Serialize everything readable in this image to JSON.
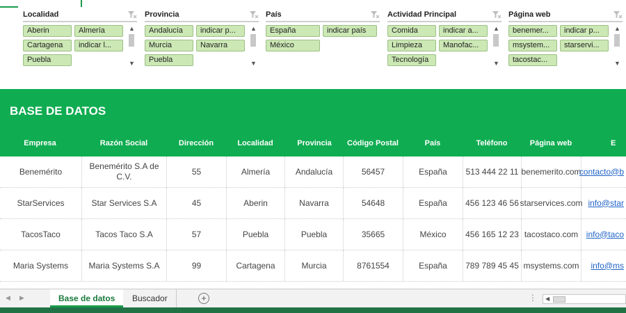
{
  "slicers": [
    {
      "title": "Localidad",
      "items": [
        "Aberin",
        "Almería",
        "Cartagena",
        "indicar l...",
        "Puebla"
      ]
    },
    {
      "title": "Provincia",
      "items": [
        "Andalucía",
        "indicar p...",
        "Murcia",
        "Navarra",
        "Puebla"
      ]
    },
    {
      "title": "País",
      "items": [
        "España",
        "indicar país",
        "México"
      ]
    },
    {
      "title": "Actividad Principal",
      "items": [
        "Comida",
        "indicar a...",
        "Limpieza",
        "Manofac...",
        "Tecnología"
      ]
    },
    {
      "title": "Página web",
      "items": [
        "benemer...",
        "indicar p...",
        "msystem...",
        "starservi...",
        "tacostac..."
      ]
    }
  ],
  "database": {
    "title": "BASE DE DATOS",
    "columns": [
      "Empresa",
      "Razón Social",
      "Dirección",
      "Localidad",
      "Provincia",
      "Código Postal",
      "País",
      "Teléfono",
      "Página web",
      "E"
    ],
    "rows": [
      [
        "Benemérito",
        "Benemérito S.A de C.V.",
        "55",
        "Almería",
        "Andalucía",
        "56457",
        "España",
        "513 444 22 11",
        "benemerito.com",
        "contacto@b"
      ],
      [
        "StarServices",
        "Star Services S.A",
        "45",
        "Aberin",
        "Navarra",
        "54648",
        "España",
        "456 123 46 56",
        "starservices.com",
        "info@star"
      ],
      [
        "TacosTaco",
        "Tacos Taco S.A",
        "57",
        "Puebla",
        "Puebla",
        "35665",
        "México",
        "456 165 12 23",
        "tacostaco.com",
        "info@taco"
      ],
      [
        "Maria Systems",
        "Maria Systems S.A",
        "99",
        "Cartagena",
        "Murcia",
        "8761554",
        "España",
        "789 789 45 45",
        "msystems.com",
        "info@ms"
      ]
    ]
  },
  "sheet_tabs": {
    "active": "Base de datos",
    "other": "Buscador",
    "add": "+",
    "more": "⋮"
  },
  "colors": {
    "header_green": "#0fac51",
    "slicer_item": "#cce8b5",
    "link": "#1f63c6",
    "status_green": "#217346"
  },
  "icons": [
    "clear-filter-icon",
    "chevron-up-icon",
    "chevron-down-icon",
    "add-sheet-icon",
    "scroll-left-icon",
    "scroll-right-icon"
  ]
}
